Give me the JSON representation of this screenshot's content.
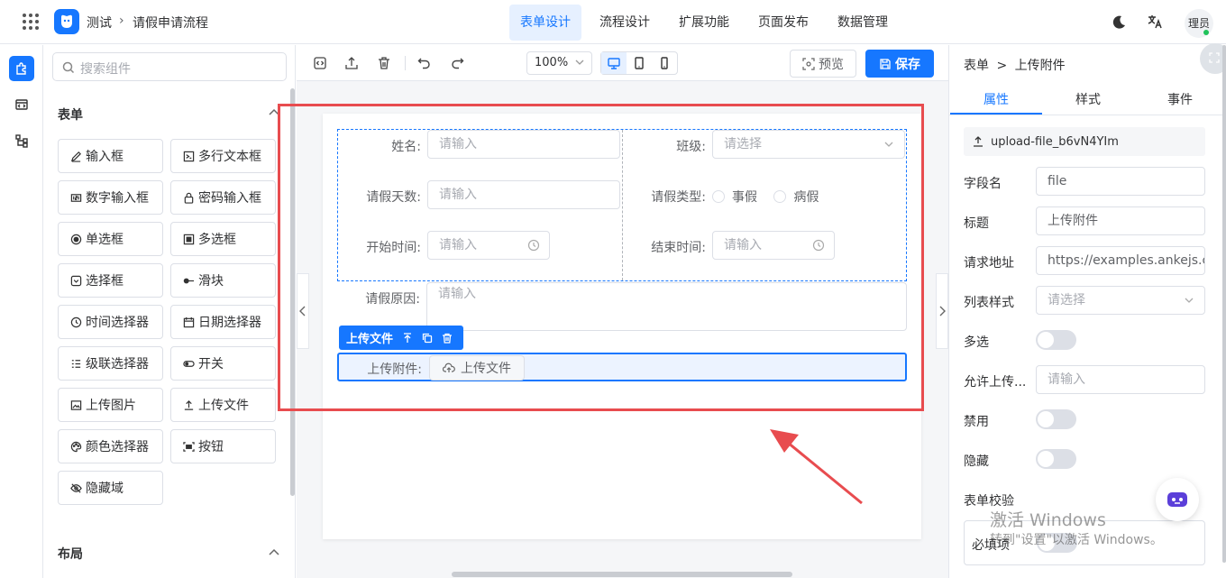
{
  "header": {
    "app_title": "测试",
    "separator": "›",
    "process_name": "请假申请流程",
    "tabs": [
      {
        "label": "表单设计",
        "active": true
      },
      {
        "label": "流程设计",
        "active": false
      },
      {
        "label": "扩展功能",
        "active": false
      },
      {
        "label": "页面发布",
        "active": false
      },
      {
        "label": "数据管理",
        "active": false
      }
    ],
    "avatar_text": "理员"
  },
  "left_panel": {
    "search_placeholder": "搜索组件",
    "form_section": "表单",
    "layout_section": "布局",
    "components": [
      {
        "label": "输入框",
        "icon": "edit-icon"
      },
      {
        "label": "多行文本框",
        "icon": "textarea-icon"
      },
      {
        "label": "数字输入框",
        "icon": "number-icon"
      },
      {
        "label": "密码输入框",
        "icon": "lock-icon"
      },
      {
        "label": "单选框",
        "icon": "radio-icon"
      },
      {
        "label": "多选框",
        "icon": "checkbox-icon"
      },
      {
        "label": "选择框",
        "icon": "select-icon"
      },
      {
        "label": "滑块",
        "icon": "slider-icon"
      },
      {
        "label": "时间选择器",
        "icon": "clock-icon"
      },
      {
        "label": "日期选择器",
        "icon": "calendar-icon"
      },
      {
        "label": "级联选择器",
        "icon": "cascader-icon"
      },
      {
        "label": "开关",
        "icon": "switch-icon"
      },
      {
        "label": "上传图片",
        "icon": "image-icon"
      },
      {
        "label": "上传文件",
        "icon": "upload-icon"
      },
      {
        "label": "颜色选择器",
        "icon": "palette-icon"
      },
      {
        "label": "按钮",
        "icon": "button-icon"
      },
      {
        "label": "隐藏域",
        "icon": "eye-off-icon"
      }
    ]
  },
  "toolbar": {
    "zoom": "100%",
    "preview_label": "预览",
    "save_label": "保存"
  },
  "form": {
    "name_label": "姓名:",
    "name_placeholder": "请输入",
    "class_label": "班级:",
    "class_placeholder": "请选择",
    "days_label": "请假天数:",
    "days_placeholder": "请输入",
    "type_label": "请假类型:",
    "type_options": [
      "事假",
      "病假"
    ],
    "start_label": "开始时间:",
    "start_placeholder": "请输入",
    "end_label": "结束时间:",
    "end_placeholder": "请输入",
    "reason_label": "请假原因:",
    "reason_placeholder": "请输入",
    "selected_tag": "上传文件",
    "upload_label": "上传附件:",
    "upload_button": "上传文件"
  },
  "right_panel": {
    "breadcrumb_root": "表单",
    "breadcrumb_sep": ">",
    "breadcrumb_current": "上传附件",
    "tabs": [
      "属性",
      "样式",
      "事件"
    ],
    "component_id": "upload-file_b6vN4YIm",
    "field_name_label": "字段名",
    "field_name_value": "file",
    "title_label": "标题",
    "title_value": "上传附件",
    "url_label": "请求地址",
    "url_value": "https://examples.ankejs.cn,",
    "list_style_label": "列表样式",
    "list_style_placeholder": "请选择",
    "multiple_label": "多选",
    "allow_label": "允许上传...",
    "allow_placeholder": "请输入",
    "disabled_label": "禁用",
    "hidden_label": "隐藏",
    "validation_label": "表单校验",
    "required_label": "必填项"
  },
  "watermark": {
    "line1": "激活 Windows",
    "line2": "转到\"设置\"以激活 Windows。"
  },
  "colors": {
    "accent": "#1677ff",
    "annotation": "#e84c4f"
  }
}
